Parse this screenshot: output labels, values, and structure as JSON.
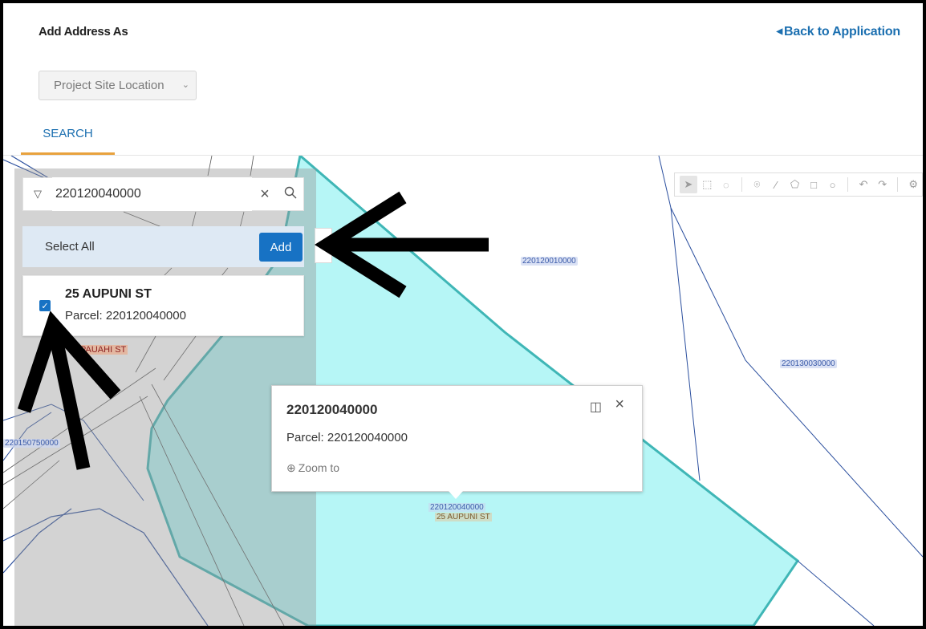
{
  "header": {
    "title": "Add Address As",
    "back_link": "Back to Application"
  },
  "address_type": {
    "selected": "Project Site Location"
  },
  "tabs": [
    {
      "label": "SEARCH",
      "active": true
    }
  ],
  "search": {
    "value": "220120040000"
  },
  "select_all": {
    "label": "Select All",
    "add_label": "Add"
  },
  "results": [
    {
      "address": "25 AUPUNI ST",
      "parcel": "Parcel: 220120040000",
      "checked": true
    }
  ],
  "map": {
    "labels": {
      "parcel_north": "220120010000",
      "parcel_east": "220130030000",
      "parcel_west": "220150750000",
      "parcel_center": "220120040000",
      "address_center": "25 AUPUNI ST",
      "road": "PAUAHI ST"
    },
    "toolbar_icons": [
      "select-icon",
      "select-rectangle-icon",
      "lasso-icon",
      "point-icon",
      "polyline-icon",
      "polygon-icon",
      "rectangle-icon",
      "circle-icon",
      "undo-icon",
      "redo-icon",
      "settings-icon"
    ]
  },
  "popup": {
    "title": "220120040000",
    "parcel": "Parcel: 220120040000",
    "zoom_label": "Zoom to"
  },
  "colors": {
    "link": "#1b6fb0",
    "tab_underline": "#e8a23e",
    "add_button": "#1772c4",
    "select_all_bg": "#dee9f4",
    "parcel_fill": "#b6f6f6",
    "parcel_stroke": "#3fb6b6",
    "frame_border": "#000000"
  }
}
